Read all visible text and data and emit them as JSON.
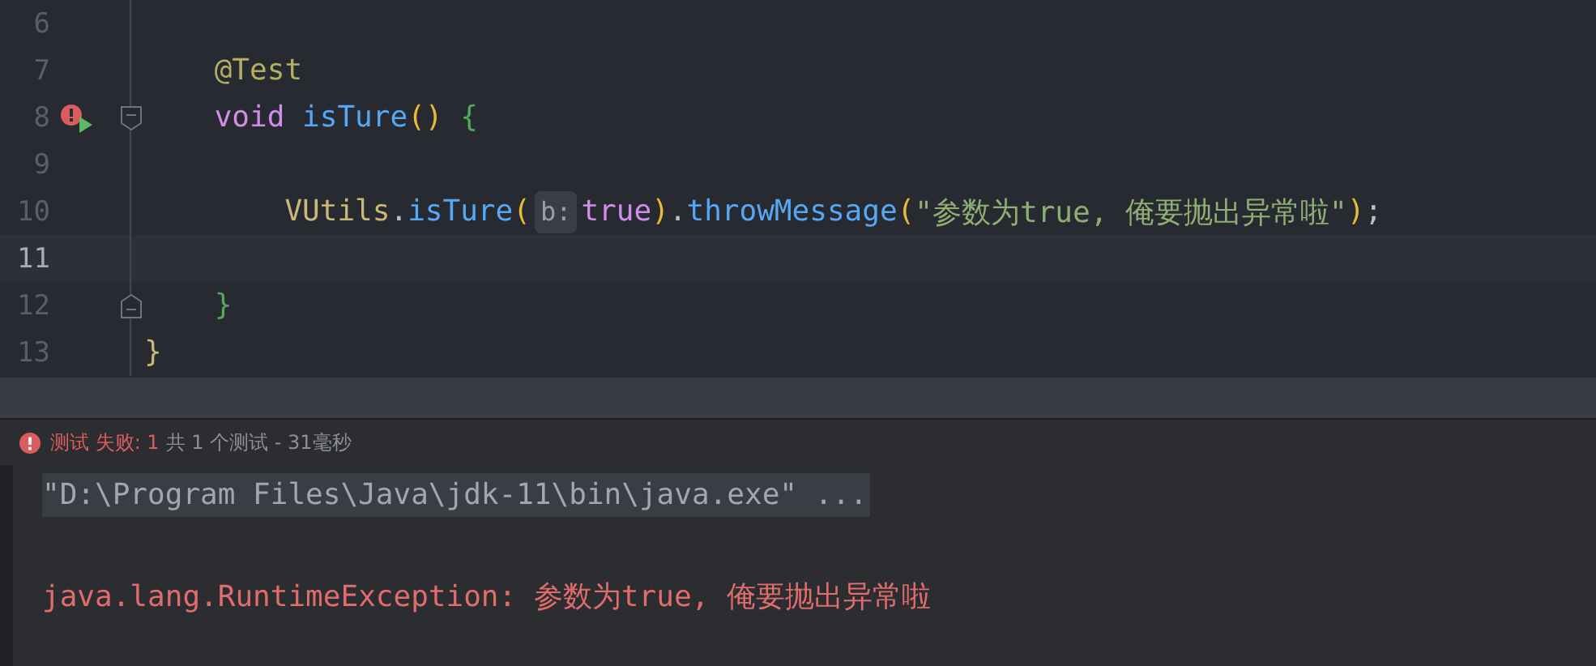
{
  "editor": {
    "lines": [
      {
        "number": "6",
        "current": false
      },
      {
        "number": "7",
        "current": false,
        "tokens": [
          {
            "text": "    @Test",
            "kind": "annotation"
          }
        ]
      },
      {
        "number": "8",
        "current": false,
        "run_failed": true,
        "fold_start": true,
        "tokens": [
          {
            "text": "    void ",
            "kind": "keyword"
          },
          {
            "text": "isTure",
            "kind": "method"
          },
          {
            "text": "() ",
            "kind": "paren"
          },
          {
            "text": "{",
            "kind": "brace"
          }
        ]
      },
      {
        "number": "9",
        "current": false
      },
      {
        "number": "10",
        "current": false,
        "tokens": [
          {
            "text": "        VUtils",
            "kind": "class"
          },
          {
            "text": ".",
            "kind": "plain"
          },
          {
            "text": "isTure",
            "kind": "method"
          },
          {
            "text": "(",
            "kind": "paren"
          },
          {
            "text": "b:",
            "kind": "hint"
          },
          {
            "text": "true",
            "kind": "literal"
          },
          {
            "text": ")",
            "kind": "paren"
          },
          {
            "text": ".",
            "kind": "plain"
          },
          {
            "text": "throwMessage",
            "kind": "method"
          },
          {
            "text": "(",
            "kind": "paren"
          },
          {
            "text": "\"参数为true, 俺要抛出异常啦\"",
            "kind": "string"
          },
          {
            "text": ")",
            "kind": "paren"
          },
          {
            "text": ";",
            "kind": "plain"
          }
        ]
      },
      {
        "number": "11",
        "current": true
      },
      {
        "number": "12",
        "current": false,
        "fold_end": true,
        "tokens": [
          {
            "text": "    }",
            "kind": "brace"
          }
        ]
      },
      {
        "number": "13",
        "current": false,
        "tokens": [
          {
            "text": "}",
            "kind": "class"
          }
        ]
      }
    ]
  },
  "test_status": {
    "failed": true,
    "result": "测试 失败: 1",
    "summary": "共 1 个测试 - 31毫秒"
  },
  "console": {
    "lines": [
      {
        "kind": "command",
        "text": "\"D:\\Program Files\\Java\\jdk-11\\bin\\java.exe\" ..."
      },
      {
        "kind": "error",
        "text": "java.lang.RuntimeException: 参数为true, 俺要抛出异常啦"
      }
    ]
  }
}
